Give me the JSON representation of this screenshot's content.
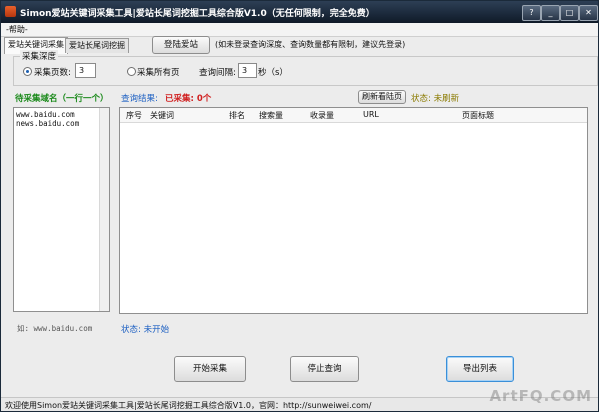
{
  "window": {
    "title": "Simon爱站关键词采集工具|爱站长尾词挖掘工具综合版V1.0（无任何限制，完全免费）",
    "controls": {
      "help": "?",
      "minimize": "_",
      "maximize": "□",
      "close": "✕"
    }
  },
  "menu": {
    "help": "-帮助-"
  },
  "tabs": [
    {
      "label": "爱站关键词采集"
    },
    {
      "label": "爱站长尾词挖掘"
    }
  ],
  "login": {
    "button": "登陆爱站",
    "note": "(如未登录查询深度、查询数量都有限制，建议先登录)"
  },
  "depth": {
    "group_title": "采集深度",
    "pages_label": "采集页数:",
    "pages_value": "3",
    "all_pages_label": "采集所有页",
    "interval_label": "查询间隔:",
    "interval_value": "3",
    "interval_unit": "秒（s）"
  },
  "domains": {
    "label": "待采集域名（一行一个）",
    "lines": [
      "www.baidu.com",
      "news.baidu.com"
    ],
    "example": "如: www.baidu.com"
  },
  "results": {
    "label": "查询结果:",
    "collected": "已采集: 0个",
    "refresh_button": "刷新看陆页",
    "state": "状态: 未刷新",
    "columns": [
      "序号",
      "关键词",
      "排名",
      "搜索量",
      "收录量",
      "URL",
      "页面标题"
    ]
  },
  "status": {
    "text": "状态: 未开始"
  },
  "actions": {
    "start": "开始采集",
    "stop": "停止查询",
    "export": "导出列表"
  },
  "statusbar": {
    "text": "欢迎使用Simon爱站关键词采集工具|爱站长尾词挖掘工具综合版V1.0，官网：http://sunweiwei.com/"
  },
  "watermark": "ArtFQ.COM"
}
